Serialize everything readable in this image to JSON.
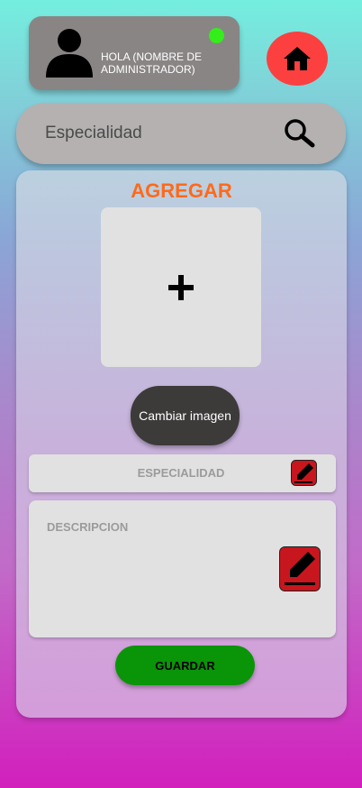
{
  "header": {
    "greeting": "HOLA (NOMBRE DE ADMINISTRADOR)",
    "status_color": "#33ee1a",
    "avatar_icon": "user-silhouette-icon",
    "home_icon": "home-icon",
    "home_button_color": "#fc4040"
  },
  "search": {
    "placeholder": "Especialidad",
    "icon": "search-icon"
  },
  "form": {
    "title": "AGREGAR",
    "title_color": "#ff6a1a",
    "image_placeholder_icon": "plus-icon",
    "change_image_label": "Cambiar imagen",
    "specialty_label": "ESPECIALIDAD",
    "description_label": "DESCRIPCION",
    "edit_icon": "edit-pencil-icon",
    "save_label": "GUARDAR",
    "save_color": "#0a9408"
  }
}
